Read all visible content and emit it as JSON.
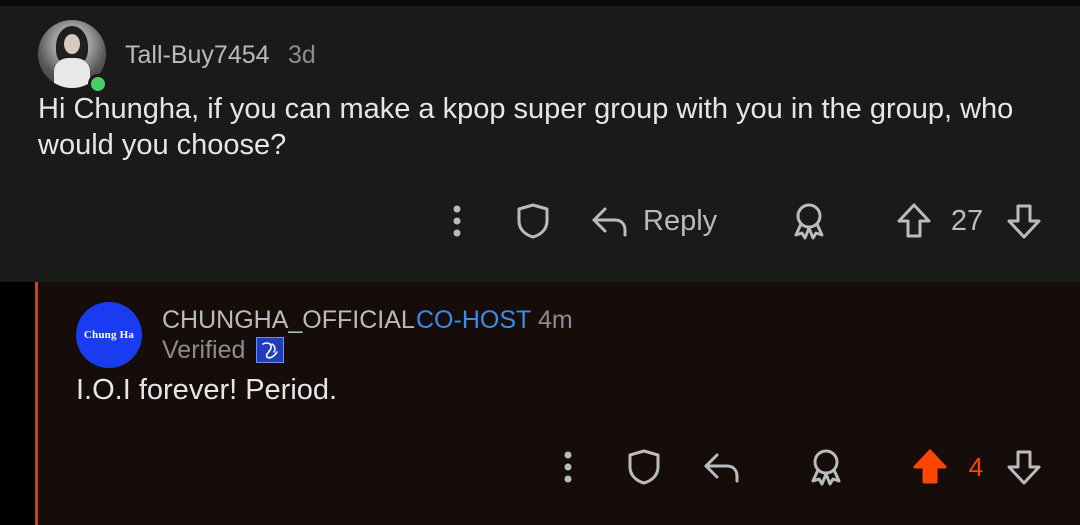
{
  "comment_parent": {
    "username": "Tall-Buy7454",
    "time": "3d",
    "body": "Hi Chungha, if you can make a kpop super group with you in the group, who would you choose?",
    "reply_label": "Reply",
    "vote_count": "27",
    "online": true
  },
  "comment_reply": {
    "avatar_text": "Chung Ha",
    "username": "CHUNGHA_OFFICIAL",
    "badge": "CO-HOST",
    "time": "4m",
    "flair_text": "Verified",
    "body": "I.O.I forever! Period.",
    "vote_count": "4",
    "upvoted": true
  },
  "icons": [
    "more-options-icon",
    "shield-icon",
    "reply-arrow-icon",
    "award-icon",
    "upvote-icon",
    "downvote-icon"
  ],
  "colors": {
    "accent_upvote": "#ff4500",
    "cohost_blue": "#3b8ce8",
    "online_green": "#46d160",
    "chungha_avatar_blue": "#1a3cf0"
  }
}
